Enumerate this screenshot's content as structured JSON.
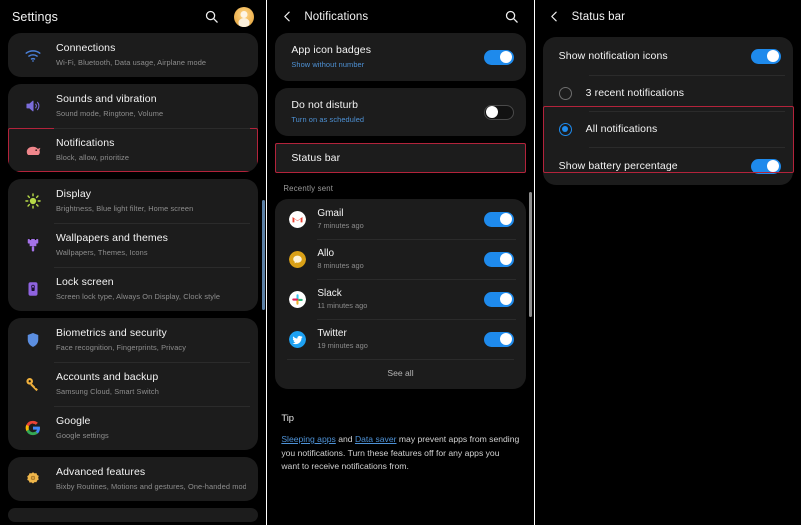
{
  "panel1": {
    "header": {
      "title": "Settings",
      "search_icon": "search-icon",
      "avatar": "profile-avatar"
    },
    "groups": [
      {
        "items": [
          {
            "icon": "wifi-icon",
            "title": "Connections",
            "subtitle": "Wi-Fi, Bluetooth, Data usage, Airplane mode",
            "highlighted": false
          }
        ]
      },
      {
        "items": [
          {
            "icon": "speaker-icon",
            "title": "Sounds and vibration",
            "subtitle": "Sound mode, Ringtone, Volume",
            "highlighted": false
          },
          {
            "icon": "notifications-icon",
            "title": "Notifications",
            "subtitle": "Block, allow, prioritize",
            "highlighted": true
          }
        ]
      },
      {
        "items": [
          {
            "icon": "brightness-icon",
            "title": "Display",
            "subtitle": "Brightness, Blue light filter, Home screen",
            "highlighted": false
          },
          {
            "icon": "paintbrush-icon",
            "title": "Wallpapers and themes",
            "subtitle": "Wallpapers, Themes, Icons",
            "highlighted": false
          },
          {
            "icon": "lock-icon",
            "title": "Lock screen",
            "subtitle": "Screen lock type, Always On Display, Clock style",
            "highlighted": false
          }
        ]
      },
      {
        "items": [
          {
            "icon": "shield-icon",
            "title": "Biometrics and security",
            "subtitle": "Face recognition, Fingerprints, Privacy",
            "highlighted": false
          },
          {
            "icon": "key-icon",
            "title": "Accounts and backup",
            "subtitle": "Samsung Cloud, Smart Switch",
            "highlighted": false
          },
          {
            "icon": "google-icon",
            "title": "Google",
            "subtitle": "Google settings",
            "highlighted": false
          }
        ]
      },
      {
        "items": [
          {
            "icon": "gear-flower-icon",
            "title": "Advanced features",
            "subtitle": "Bixby Routines, Motions and gestures, One-handed mode",
            "highlighted": false
          }
        ]
      }
    ]
  },
  "panel2": {
    "header": {
      "back_icon": "back-arrow-icon",
      "title": "Notifications",
      "search_icon": "search-icon"
    },
    "settings": [
      {
        "title": "App icon badges",
        "subtitle": "Show without number",
        "toggle": "on"
      },
      {
        "title": "Do not disturb",
        "subtitle": "Turn on as scheduled",
        "toggle": "off"
      }
    ],
    "status_bar_item": {
      "title": "Status bar",
      "highlighted": true
    },
    "recently_sent_label": "Recently sent",
    "apps": [
      {
        "icon": "gmail-icon",
        "name": "Gmail",
        "time": "7 minutes ago",
        "toggle": "on"
      },
      {
        "icon": "allo-icon",
        "name": "Allo",
        "time": "8 minutes ago",
        "toggle": "on"
      },
      {
        "icon": "slack-icon",
        "name": "Slack",
        "time": "11 minutes ago",
        "toggle": "on"
      },
      {
        "icon": "twitter-icon",
        "name": "Twitter",
        "time": "19 minutes ago",
        "toggle": "on"
      }
    ],
    "see_all_label": "See all",
    "tip": {
      "heading": "Tip",
      "link1": "Sleeping apps",
      "mid": " and ",
      "link2": "Data saver",
      "rest": " may prevent apps from sending you notifications. Turn these features off for any apps you want to receive notifications from."
    }
  },
  "panel3": {
    "header": {
      "back_icon": "back-arrow-icon",
      "title": "Status bar"
    },
    "items": [
      {
        "type": "toggle",
        "title": "Show notification icons",
        "toggle": "on"
      },
      {
        "type": "radio",
        "title": "3 recent notifications",
        "selected": false
      },
      {
        "type": "radio",
        "title": "All notifications",
        "selected": true
      },
      {
        "type": "toggle",
        "title": "Show battery percentage",
        "toggle": "on"
      }
    ]
  },
  "colors": {
    "accent_blue": "#1e8aec",
    "highlight_red": "#b3233b",
    "card_bg": "#1c1c1c",
    "page_bg": "#000000",
    "link_blue": "#4e92d6"
  }
}
